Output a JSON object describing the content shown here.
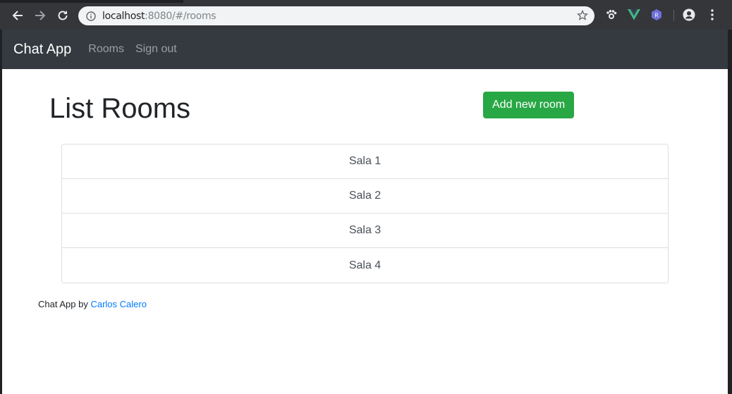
{
  "browser": {
    "url_host": "localhost",
    "url_rest": ":8080/#/rooms"
  },
  "navbar": {
    "brand": "Chat App",
    "links": [
      "Rooms",
      "Sign out"
    ]
  },
  "page": {
    "title": "List Rooms",
    "add_button": "Add new room"
  },
  "rooms": [
    "Sala 1",
    "Sala 2",
    "Sala 3",
    "Sala 4"
  ],
  "footer": {
    "prefix": "Chat App by",
    "author": "Carlos Calero"
  },
  "colors": {
    "navbar_bg": "#343a40",
    "success": "#28a745",
    "link": "#007bff"
  }
}
